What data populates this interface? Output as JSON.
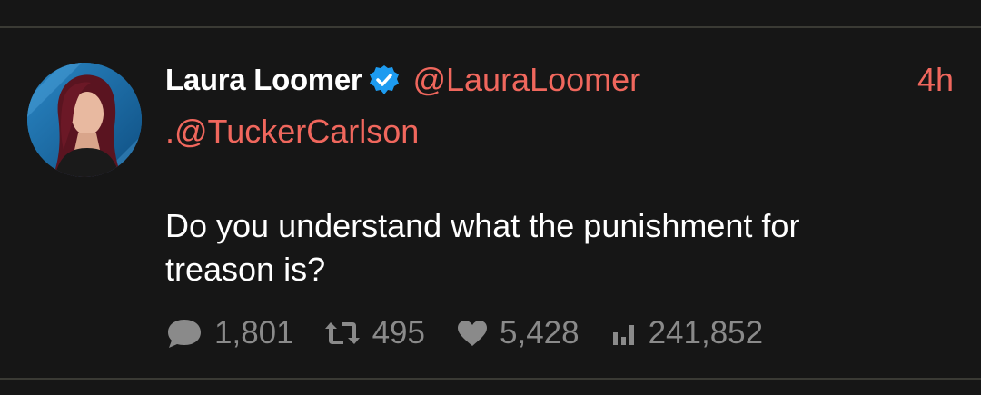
{
  "tweet": {
    "author": {
      "display_name": "Laura Loomer",
      "handle": "@LauraLoomer",
      "verified": true,
      "avatar_icon": "profile-photo"
    },
    "timestamp": "4h",
    "mention": ".@TuckerCarlson",
    "text": "Do you understand what the punishment for treason is?",
    "stats": {
      "replies": "1,801",
      "retweets": "495",
      "likes": "5,428",
      "views": "241,852"
    }
  },
  "colors": {
    "background": "#161616",
    "divider": "#3a3a34",
    "accent": "#f0675d",
    "text": "#ffffff",
    "muted": "#8a8a8a",
    "verified": "#1d9bf0"
  },
  "icons": {
    "reply": "speech-bubble-icon",
    "retweet": "retweet-icon",
    "like": "heart-icon",
    "views": "bar-chart-icon",
    "verified": "verified-badge-icon"
  }
}
